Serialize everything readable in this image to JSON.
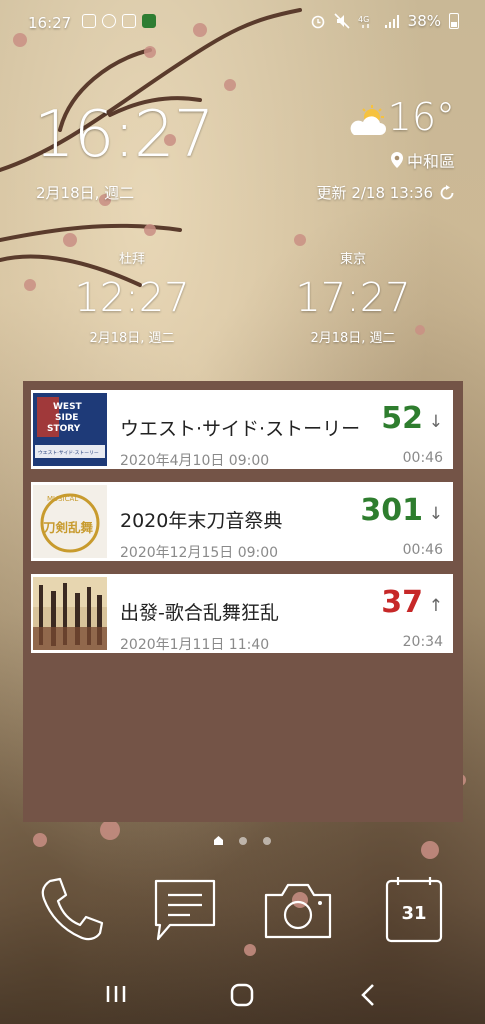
{
  "status_bar": {
    "time": "16:27",
    "battery": "38%",
    "left_icons": [
      "gmail-icon",
      "line-icon",
      "instagram-icon",
      "app-icon"
    ],
    "right_icons": [
      "alarm-icon",
      "mute-icon",
      "4g-icon",
      "signal-icon",
      "battery-icon"
    ]
  },
  "clock": {
    "time": "16:27",
    "date": "2月18日, 週二"
  },
  "weather": {
    "temperature": "16°",
    "location": "中和區",
    "update": "更新 2/18 13:36"
  },
  "world_clocks": [
    {
      "city": "杜拜",
      "time": "12:27",
      "date": "2月18日, 週二"
    },
    {
      "city": "東京",
      "time": "17:27",
      "date": "2月18日, 週二"
    }
  ],
  "countdowns": [
    {
      "title": "ウエスト·サイド·ストーリー",
      "datetime": "2020年4月10日 09:00",
      "count": "52",
      "direction": "↓",
      "elapsed": "00:46",
      "count_color": "#2e7d2e"
    },
    {
      "title": "2020年末刀音祭典",
      "datetime": "2020年12月15日 09:00",
      "count": "301",
      "direction": "↓",
      "elapsed": "00:46",
      "count_color": "#2e7d2e"
    },
    {
      "title": "出發-歌合乱舞狂乱",
      "datetime": "2020年1月11日 11:40",
      "count": "37",
      "direction": "↑",
      "elapsed": "20:34",
      "count_color": "#c62828"
    }
  ],
  "poster_text": {
    "card1_line1": "WEST",
    "card1_line2": "SIDE",
    "card1_line3": "STORY",
    "card1_caption": "ウエスト·サイド·ストーリー",
    "card2_banner": "MUSICAL",
    "card2_logo": "刀剣乱舞"
  },
  "dock": [
    "phone-icon",
    "messages-icon",
    "camera-icon",
    "calendar-icon"
  ],
  "calendar_day": "31",
  "colors": {
    "widget_bg": "#745447",
    "up_color": "#c62828",
    "down_color": "#2e7d2e"
  }
}
